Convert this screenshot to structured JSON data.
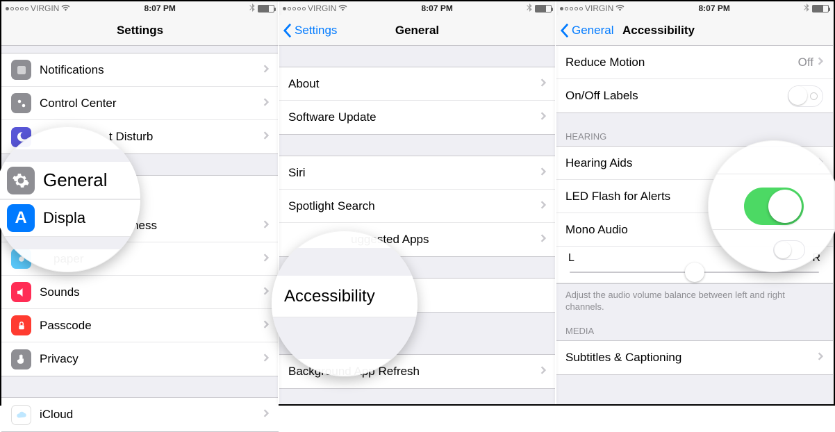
{
  "statusbar": {
    "carrier": "VIRGIN",
    "time": "8:07 PM"
  },
  "screen1": {
    "title": "Settings",
    "items_pre": [
      "Notifications",
      "Control Center"
    ],
    "dnd_partial": "t Disturb",
    "lens": {
      "general": "General",
      "display_partial": "Displa",
      "wallpaper_partial": "paper",
      "brightness_partial": "rightness"
    },
    "items_post": [
      "Sounds",
      "Passcode",
      "Privacy"
    ],
    "group2_first": "iCloud"
  },
  "screen2": {
    "back": "Settings",
    "title": "General",
    "g1": [
      "About",
      "Software Update"
    ],
    "g2_pre": [
      "Siri",
      "Spotlight Search"
    ],
    "g2_mid_partial": "uggested Apps",
    "lens_label": "Accessibility",
    "g3": [
      "Background App Refresh"
    ]
  },
  "screen3": {
    "back": "General",
    "title": "Accessibility",
    "reduce_motion": "Reduce Motion",
    "reduce_motion_value": "Off",
    "onoff_labels": "On/Off Labels",
    "section_hearing": "HEARING",
    "hearing_aids": "Hearing Aids",
    "led_flash": "LED Flash for Alerts",
    "mono_audio": "Mono Audio",
    "slider": {
      "left": "L",
      "right": "R"
    },
    "footer": "Adjust the audio volume balance between left and right channels.",
    "section_media": "MEDIA",
    "subtitles": "Subtitles & Captioning"
  }
}
